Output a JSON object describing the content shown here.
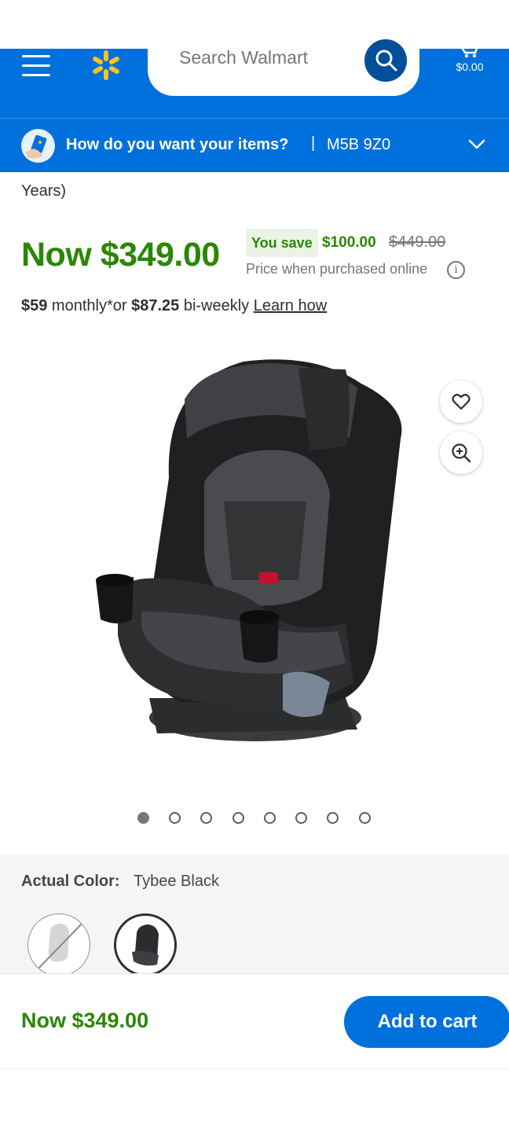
{
  "header": {
    "search_placeholder": "Search Walmart",
    "cart_total": "$0.00",
    "colors": {
      "brand_blue": "#0071dc",
      "spark_yellow": "#ffc220"
    }
  },
  "fulfillment": {
    "question": "How do you want your items?",
    "separator": "|",
    "postal_code": "M5B 9Z0"
  },
  "product": {
    "title_tail": "Years)",
    "now_price": "Now $349.00",
    "you_save_label": "You save",
    "save_amount": "$100.00",
    "was_price": "$449.00",
    "price_note": "Price when purchased online",
    "monthly_amount": "$59",
    "monthly_text": " monthly*or ",
    "biweekly_amount": "$87.25",
    "biweekly_text": " bi-weekly ",
    "learn_how": "Learn how",
    "image_count": 8,
    "active_image": 1
  },
  "variants": {
    "color_label": "Actual Color:",
    "color_value": "Tybee Black"
  },
  "sticky": {
    "price": "Now $349.00",
    "add_to_cart": "Add to cart"
  },
  "icons": [
    "menu-icon",
    "walmart-spark-icon",
    "search-icon",
    "cart-icon",
    "fulfillment-icon",
    "chevron-down-icon",
    "info-icon",
    "heart-icon",
    "zoom-in-icon"
  ]
}
